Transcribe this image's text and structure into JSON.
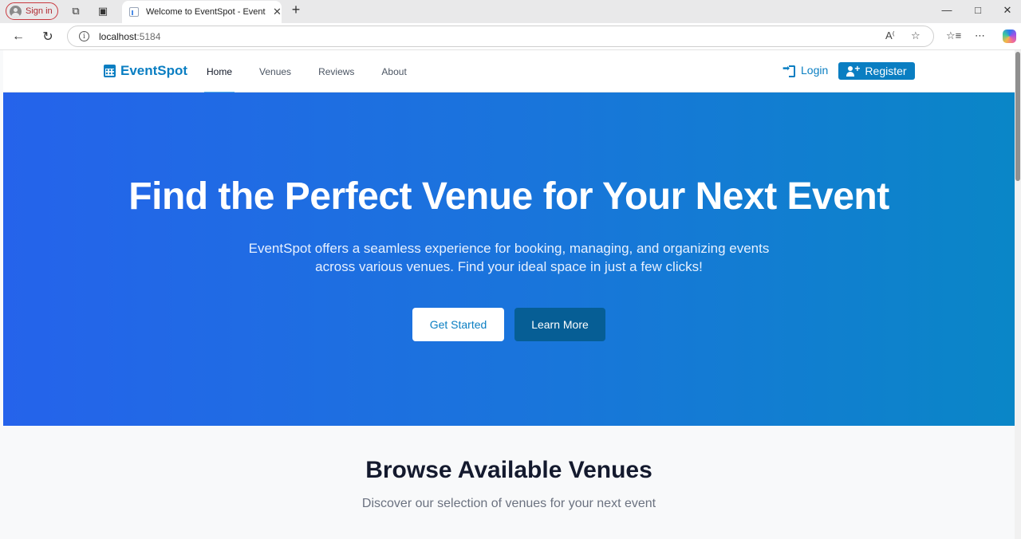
{
  "browser": {
    "signin_label": "Sign in",
    "tab_title": "Welcome to EventSpot - EventSpot",
    "url_host": "localhost",
    "url_port": ":5184"
  },
  "nav": {
    "brand": "EventSpot",
    "links": [
      {
        "label": "Home",
        "active": true
      },
      {
        "label": "Venues"
      },
      {
        "label": "Reviews"
      },
      {
        "label": "About"
      }
    ],
    "login": "Login",
    "register": "Register"
  },
  "hero": {
    "title": "Find the Perfect Venue for Your Next Event",
    "subtitle": "EventSpot offers a seamless experience for booking, managing, and organizing events across various venues. Find your ideal space in just a few clicks!",
    "primary_button": "Get Started",
    "secondary_button": "Learn More"
  },
  "venues": {
    "title": "Browse Available Venues",
    "subtitle": "Discover our selection of venues for your next event"
  },
  "colors": {
    "brand": "#0a7ec2",
    "hero_gradient_start": "#2563eb",
    "hero_gradient_end": "#0a86c7",
    "learn_more_bg": "#065e95"
  }
}
